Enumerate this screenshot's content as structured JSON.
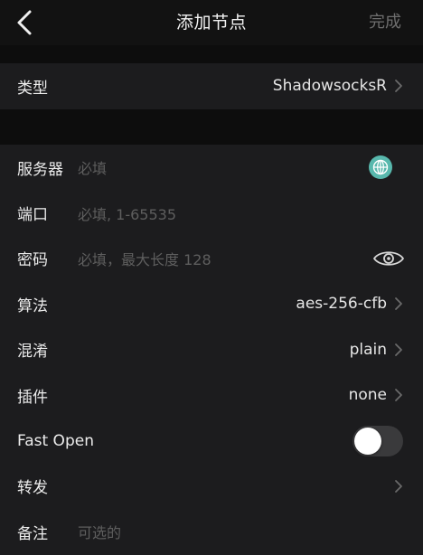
{
  "nav": {
    "title": "添加节点",
    "done_label": "完成",
    "back_icon": "chevron-left-icon"
  },
  "type_row": {
    "label": "类型",
    "value": "ShadowsocksR"
  },
  "rows": {
    "server": {
      "label": "服务器",
      "placeholder": "必填",
      "icon": "globe-icon"
    },
    "port": {
      "label": "端口",
      "placeholder": "必填, 1-65535"
    },
    "password": {
      "label": "密码",
      "placeholder": "必填，最大长度 128",
      "icon": "eye-icon"
    },
    "method": {
      "label": "算法",
      "value": "aes-256-cfb"
    },
    "obfs": {
      "label": "混淆",
      "value": "plain"
    },
    "plugin": {
      "label": "插件",
      "value": "none"
    },
    "fast_open": {
      "label": "Fast Open",
      "enabled": false
    },
    "forward": {
      "label": "转发"
    },
    "note": {
      "label": "备注",
      "placeholder": "可选的"
    }
  },
  "colors": {
    "background": "#0d0d0d",
    "group": "#1c1c1e",
    "globe": "#58b8ad",
    "placeholder": "#5e5e5e",
    "done": "#6e6e6e"
  }
}
